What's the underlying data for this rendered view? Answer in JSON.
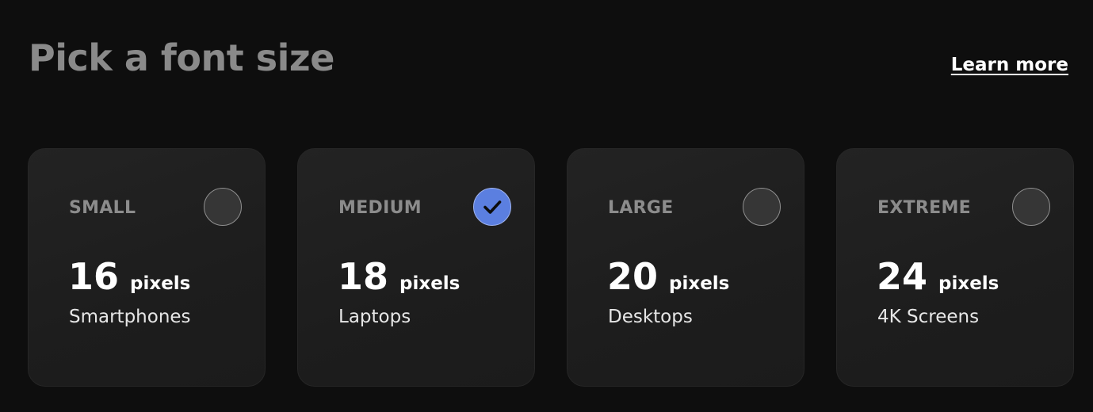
{
  "header": {
    "title": "Pick a font size",
    "learn_more": "Learn more"
  },
  "theme": {
    "background": "#0e0e0e",
    "card_background": "#1f1f1f",
    "accent": "#5b7fe0",
    "title_color": "#8a8a8a"
  },
  "options": [
    {
      "label": "SMALL",
      "size": "16",
      "unit": "pixels",
      "device": "Smartphones",
      "selected": false,
      "icon": "radio-empty-icon"
    },
    {
      "label": "MEDIUM",
      "size": "18",
      "unit": "pixels",
      "device": "Laptops",
      "selected": true,
      "icon": "checkmark-icon"
    },
    {
      "label": "LARGE",
      "size": "20",
      "unit": "pixels",
      "device": "Desktops",
      "selected": false,
      "icon": "radio-empty-icon"
    },
    {
      "label": "EXTREME",
      "size": "24",
      "unit": "pixels",
      "device": "4K Screens",
      "selected": false,
      "icon": "radio-empty-icon"
    }
  ]
}
